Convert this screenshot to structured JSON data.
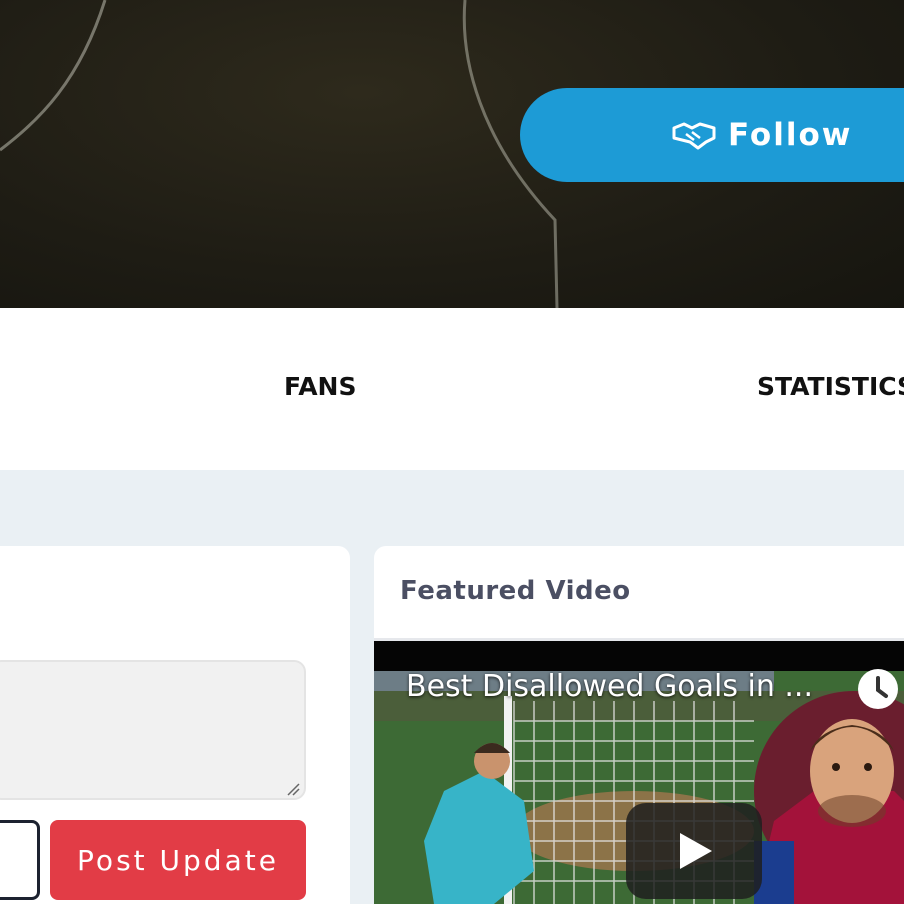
{
  "hero": {
    "follow_label": "Follow",
    "follow_icon": "handshake-icon",
    "accent": "#1d9bd6"
  },
  "tabs": [
    {
      "label": "FANS"
    },
    {
      "label": "STATISTICS"
    }
  ],
  "composer": {
    "post_label": "Post Update",
    "post_color": "#e23c46"
  },
  "featured": {
    "title": "Featured Video",
    "video_title": "Best Disallowed Goals in ...",
    "clock_icon": "clock-icon",
    "play_icon": "play-icon"
  }
}
